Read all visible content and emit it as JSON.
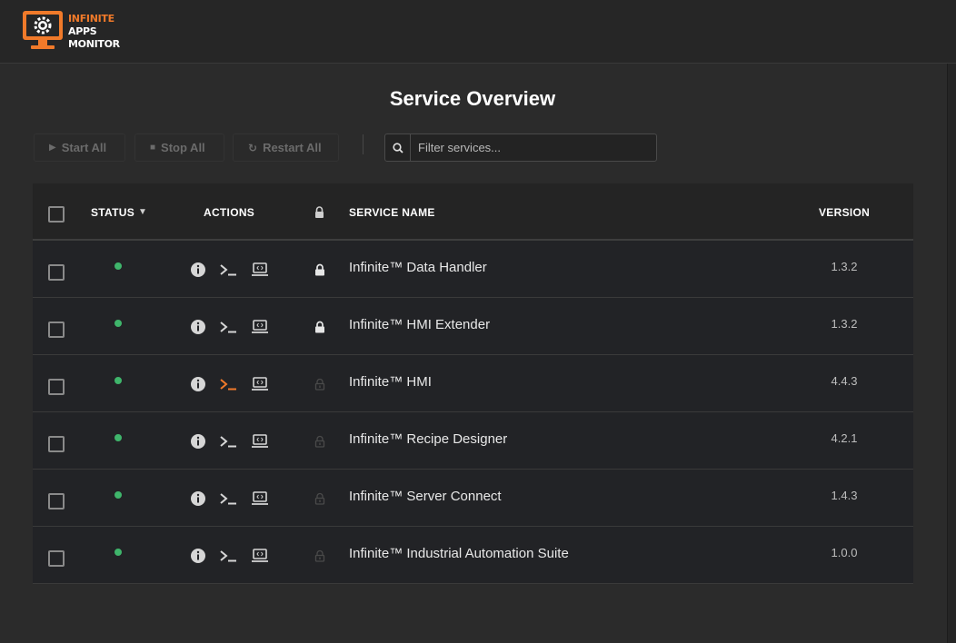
{
  "app": {
    "logo_lines": [
      "INFINITE",
      "APPS",
      "MONITOR"
    ],
    "brand_color": "#f07a2a"
  },
  "page": {
    "title": "Service Overview"
  },
  "toolbar": {
    "start_label": "Start All",
    "stop_label": "Stop All",
    "restart_label": "Restart All",
    "search_placeholder": "Filter services..."
  },
  "table": {
    "headers": {
      "status": "STATUS",
      "actions": "ACTIONS",
      "service_name": "SERVICE NAME",
      "version": "VERSION"
    },
    "rows": [
      {
        "status": "running",
        "name": "Infinite™ Data Handler",
        "version": "1.3.2",
        "locked": true
      },
      {
        "status": "running",
        "name": "Infinite™ HMI Extender",
        "version": "1.3.2",
        "locked": true
      },
      {
        "status": "running",
        "name": "Infinite™ HMI",
        "version": "4.4.3",
        "locked": false,
        "terminal_active": true
      },
      {
        "status": "running",
        "name": "Infinite™ Recipe Designer",
        "version": "4.2.1",
        "locked": false
      },
      {
        "status": "running",
        "name": "Infinite™ Server Connect",
        "version": "1.4.3",
        "locked": false
      },
      {
        "status": "running",
        "name": "Infinite™ Industrial Automation Suite",
        "version": "1.0.0",
        "locked": false
      }
    ]
  },
  "colors": {
    "status_running": "#3fb56b",
    "terminal_active": "#f07a2a"
  },
  "icons": [
    "play-icon",
    "stop-icon",
    "restart-icon",
    "search-icon",
    "sort-desc-icon",
    "lock-icon",
    "info-icon",
    "terminal-icon",
    "web-ui-icon"
  ]
}
